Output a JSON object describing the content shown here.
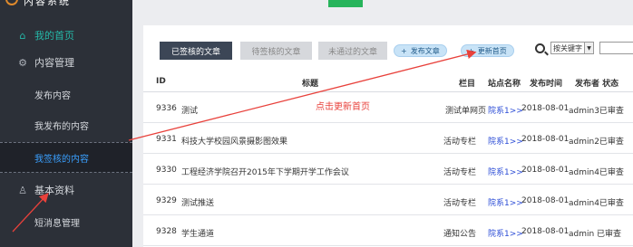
{
  "sidebar": {
    "brand": "内容系统",
    "home": "我的首页",
    "content_mgmt": "内容管理",
    "publish": "发布内容",
    "my_published": "我发布的内容",
    "my_signed": "我签核的内容",
    "basic_info": "基本资料",
    "sms": "短消息管理"
  },
  "tabs": {
    "signed": "已签核的文章",
    "pending": "待签核的文章",
    "rejected": "未通过的文章"
  },
  "actions": {
    "publish_article": "发布文章",
    "update_home": "更新首页",
    "plus": "+"
  },
  "search": {
    "select_value": "按关键字",
    "arrow": "▼"
  },
  "table": {
    "headers": {
      "id": "ID",
      "title": "标题",
      "column": "栏目",
      "site": "站点名称",
      "time": "发布时间",
      "publisher_status": "发布者 状态"
    },
    "rows": [
      {
        "id": "9336",
        "title": "测试",
        "column": "测试单网页",
        "site": "院系1>>",
        "time": "2018-08-01",
        "publisher": "admin3已审查"
      },
      {
        "id": "9331",
        "title": "科技大学校园风景摄影图效果",
        "column": "活动专栏",
        "site": "院系1>>",
        "time": "2018-08-01",
        "publisher": "admin2已审查"
      },
      {
        "id": "9330",
        "title": "工程经济学院召开2015年下学期开学工作会议",
        "column": "活动专栏",
        "site": "院系1>>",
        "time": "2018-08-01",
        "publisher": "admin4已审查"
      },
      {
        "id": "9329",
        "title": "测试推送",
        "column": "活动专栏",
        "site": "院系1>>",
        "time": "2018-08-01",
        "publisher": "admin4已审查"
      },
      {
        "id": "9328",
        "title": "学生通道",
        "column": "通知公告",
        "site": "院系1>>",
        "time": "2018-08-01",
        "publisher": " admin 已审查"
      }
    ]
  },
  "annotation": "点击更新首页",
  "colors": {
    "sidebar_bg": "#2c3038",
    "accent_teal": "#25b7a7",
    "accent_blue": "#3aa0ff",
    "annotation_red": "#e8413b"
  }
}
